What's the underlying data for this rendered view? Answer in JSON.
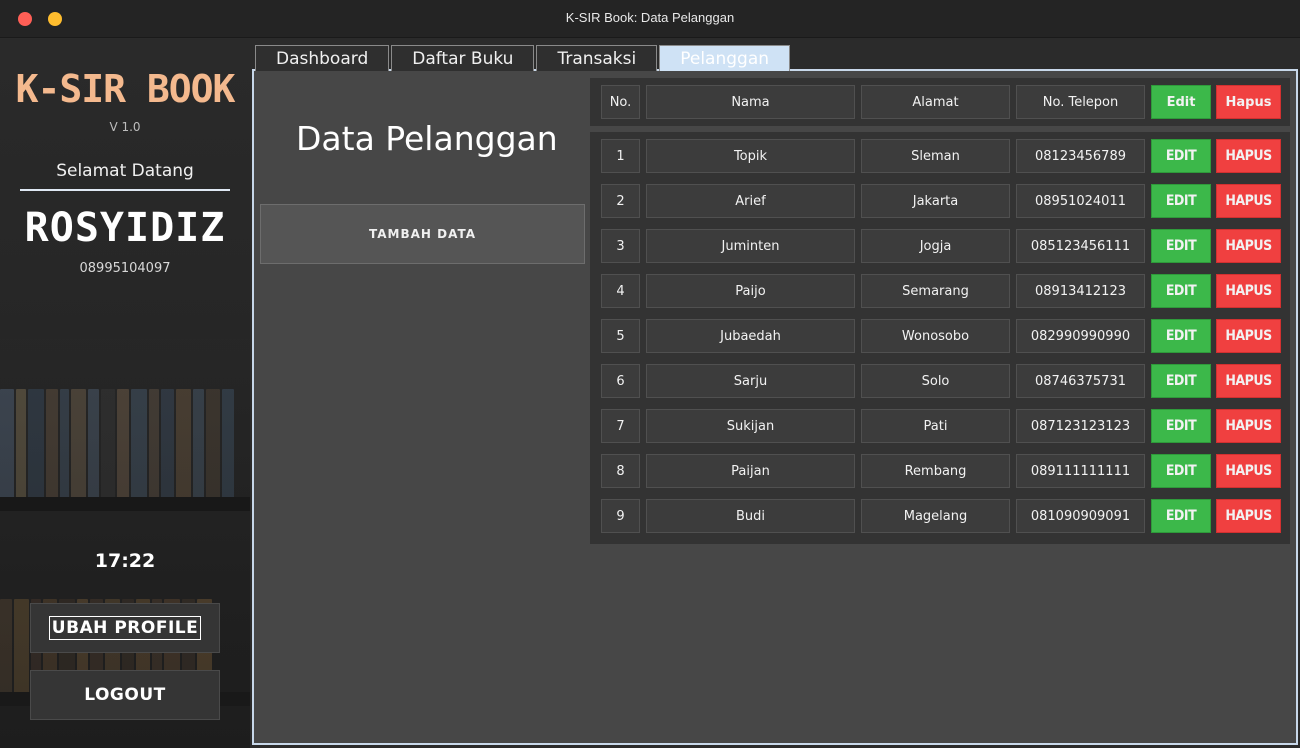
{
  "window": {
    "title": "K-SIR Book: Data Pelanggan"
  },
  "sidebar": {
    "brand": "K-SIR BOOK",
    "version": "V 1.0",
    "welcome": "Selamat Datang",
    "username": "ROSYIDIZ",
    "phone": "08995104097",
    "clock": "17:22",
    "profile_button": "UBAH PROFILE",
    "logout_button": "LOGOUT"
  },
  "tabs": [
    {
      "label": "Dashboard"
    },
    {
      "label": "Daftar Buku"
    },
    {
      "label": "Transaksi"
    },
    {
      "label": "Pelanggan"
    }
  ],
  "main": {
    "title": "Data Pelanggan",
    "add_button": "TAMBAH DATA",
    "table": {
      "headers": {
        "no": "No.",
        "nama": "Nama",
        "alamat": "Alamat",
        "telp": "No. Telepon",
        "edit": "Edit",
        "hapus": "Hapus"
      },
      "rows": [
        {
          "no": "1",
          "nama": "Topik",
          "alamat": "Sleman",
          "telp": "08123456789",
          "edit": "EDIT",
          "hapus": "HAPUS"
        },
        {
          "no": "2",
          "nama": "Arief",
          "alamat": "Jakarta",
          "telp": "08951024011",
          "edit": "EDIT",
          "hapus": "HAPUS"
        },
        {
          "no": "3",
          "nama": "Juminten",
          "alamat": "Jogja",
          "telp": "085123456111",
          "edit": "EDIT",
          "hapus": "HAPUS"
        },
        {
          "no": "4",
          "nama": "Paijo",
          "alamat": "Semarang",
          "telp": "08913412123",
          "edit": "EDIT",
          "hapus": "HAPUS"
        },
        {
          "no": "5",
          "nama": "Jubaedah",
          "alamat": "Wonosobo",
          "telp": "082990990990",
          "edit": "EDIT",
          "hapus": "HAPUS"
        },
        {
          "no": "6",
          "nama": "Sarju",
          "alamat": "Solo",
          "telp": "08746375731",
          "edit": "EDIT",
          "hapus": "HAPUS"
        },
        {
          "no": "7",
          "nama": "Sukijan",
          "alamat": "Pati",
          "telp": "087123123123",
          "edit": "EDIT",
          "hapus": "HAPUS"
        },
        {
          "no": "8",
          "nama": "Paijan",
          "alamat": "Rembang",
          "telp": "089111111111",
          "edit": "EDIT",
          "hapus": "HAPUS"
        },
        {
          "no": "9",
          "nama": "Budi",
          "alamat": "Magelang",
          "telp": "081090909091",
          "edit": "EDIT",
          "hapus": "HAPUS"
        }
      ]
    }
  },
  "colors": {
    "brand": "#f4b98e",
    "edit": "#3cb84a",
    "hapus": "#f04040",
    "active_tab": "#cfe2f5"
  }
}
